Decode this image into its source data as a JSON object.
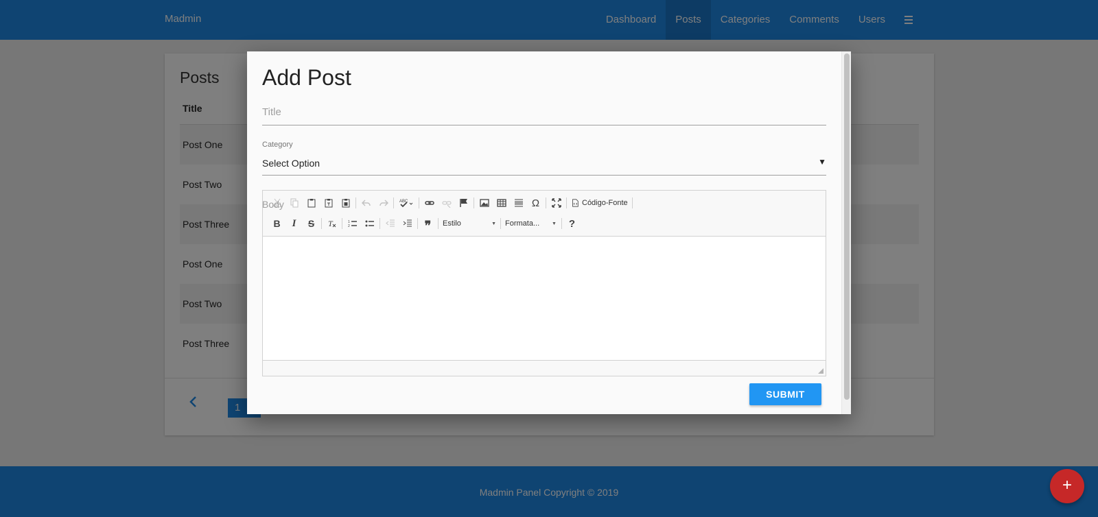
{
  "navbar": {
    "brand": "Madmin",
    "items": [
      {
        "label": "Dashboard",
        "active": false
      },
      {
        "label": "Posts",
        "active": true
      },
      {
        "label": "Categories",
        "active": false
      },
      {
        "label": "Comments",
        "active": false
      },
      {
        "label": "Users",
        "active": false
      }
    ],
    "menu_icon": "hamburger-icon"
  },
  "posts_card": {
    "title": "Posts",
    "column_header": "Title",
    "rows": [
      "Post One",
      "Post Two",
      "Post Three",
      "Post One",
      "Post Two",
      "Post Three"
    ],
    "pagination": {
      "prev_icon": "chevron-left-icon",
      "current_page": "1"
    }
  },
  "footer": {
    "text": "Madmin Panel Copyright © 2019"
  },
  "fab": {
    "icon": "plus-icon",
    "label": "+"
  },
  "modal": {
    "title": "Add Post",
    "title_field": {
      "placeholder": "Title",
      "value": ""
    },
    "category": {
      "label": "Category",
      "selected": "Select Option",
      "arrow": "▼"
    },
    "body_label": "Body",
    "editor": {
      "source_label": "Código-Fonte",
      "style_combo": "Estilo",
      "format_combo": "Formata...",
      "help_label": "?",
      "bold_label": "B",
      "italic_label": "I",
      "strike_label": "S",
      "special_char_label": "Ω",
      "quote_label": "❞"
    },
    "submit_label": "SUBMIT"
  },
  "colors": {
    "primary": "#1e88e5",
    "button": "#2196f3",
    "fab": "#c62828"
  }
}
